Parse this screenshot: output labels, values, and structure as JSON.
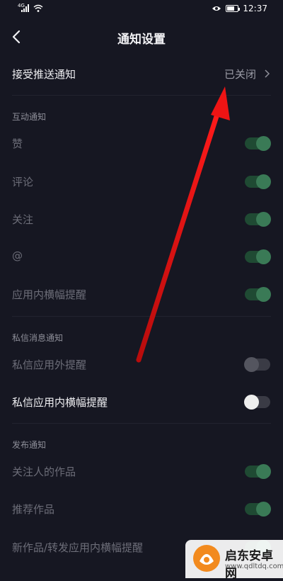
{
  "status_bar": {
    "signal_label": "4G",
    "time": "12:37"
  },
  "header": {
    "title": "通知设置"
  },
  "push": {
    "label": "接受推送通知",
    "value": "已关闭"
  },
  "sections": {
    "interaction": "互动通知",
    "messages": "私信消息通知",
    "publish": "发布通知"
  },
  "items": {
    "like": {
      "label": "赞",
      "on": true
    },
    "comment": {
      "label": "评论",
      "on": true
    },
    "follow": {
      "label": "关注",
      "on": true
    },
    "mention": {
      "label": "@",
      "on": true
    },
    "in_app_banner": {
      "label": "应用内横幅提醒",
      "on": true
    },
    "dm_outside": {
      "label": "私信应用外提醒",
      "on": false
    },
    "dm_inside_banner": {
      "label": "私信应用内横幅提醒",
      "on": false
    },
    "followed_works": {
      "label": "关注人的作品",
      "on": true
    },
    "recommended_works": {
      "label": "推荐作品",
      "on": true
    },
    "new_repost_banner": {
      "label": "新作品/转发应用内横幅提醒",
      "on": true
    }
  },
  "watermark": {
    "name": "启东安卓网",
    "url": "www.qdltdq.com"
  },
  "colors": {
    "background": "#161722",
    "toggle_on": "#3a7a56",
    "arrow": "#e01010"
  }
}
